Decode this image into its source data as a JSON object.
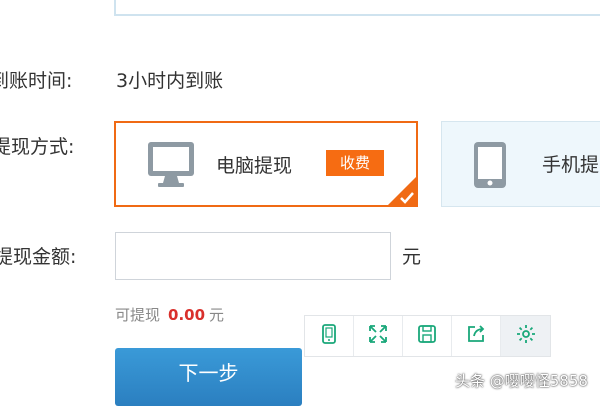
{
  "rows": {
    "arrival_label": "到账时间:",
    "arrival_value": "3小时内到账",
    "method_label": "提现方式:",
    "amount_label": "提现金额:"
  },
  "methods": {
    "pc": {
      "label": "电脑提现",
      "badge": "收费",
      "selected": true
    },
    "mobile": {
      "label": "手机提"
    }
  },
  "amount": {
    "value": "",
    "placeholder": "",
    "unit": "元"
  },
  "available": {
    "label": "可提现",
    "amount": "0.00",
    "unit": "元"
  },
  "toolbar": {
    "items": [
      "tablet-icon",
      "fullscreen-icon",
      "save-icon",
      "share-icon",
      "settings-icon"
    ],
    "accent": "#1aa87a"
  },
  "next_button": {
    "label": "下一步"
  },
  "watermark": "头条 @嘤嘤怪5858",
  "colors": {
    "brand_orange": "#f06a14",
    "primary_blue": "#2b88cc",
    "amount_red": "#d9302c"
  }
}
